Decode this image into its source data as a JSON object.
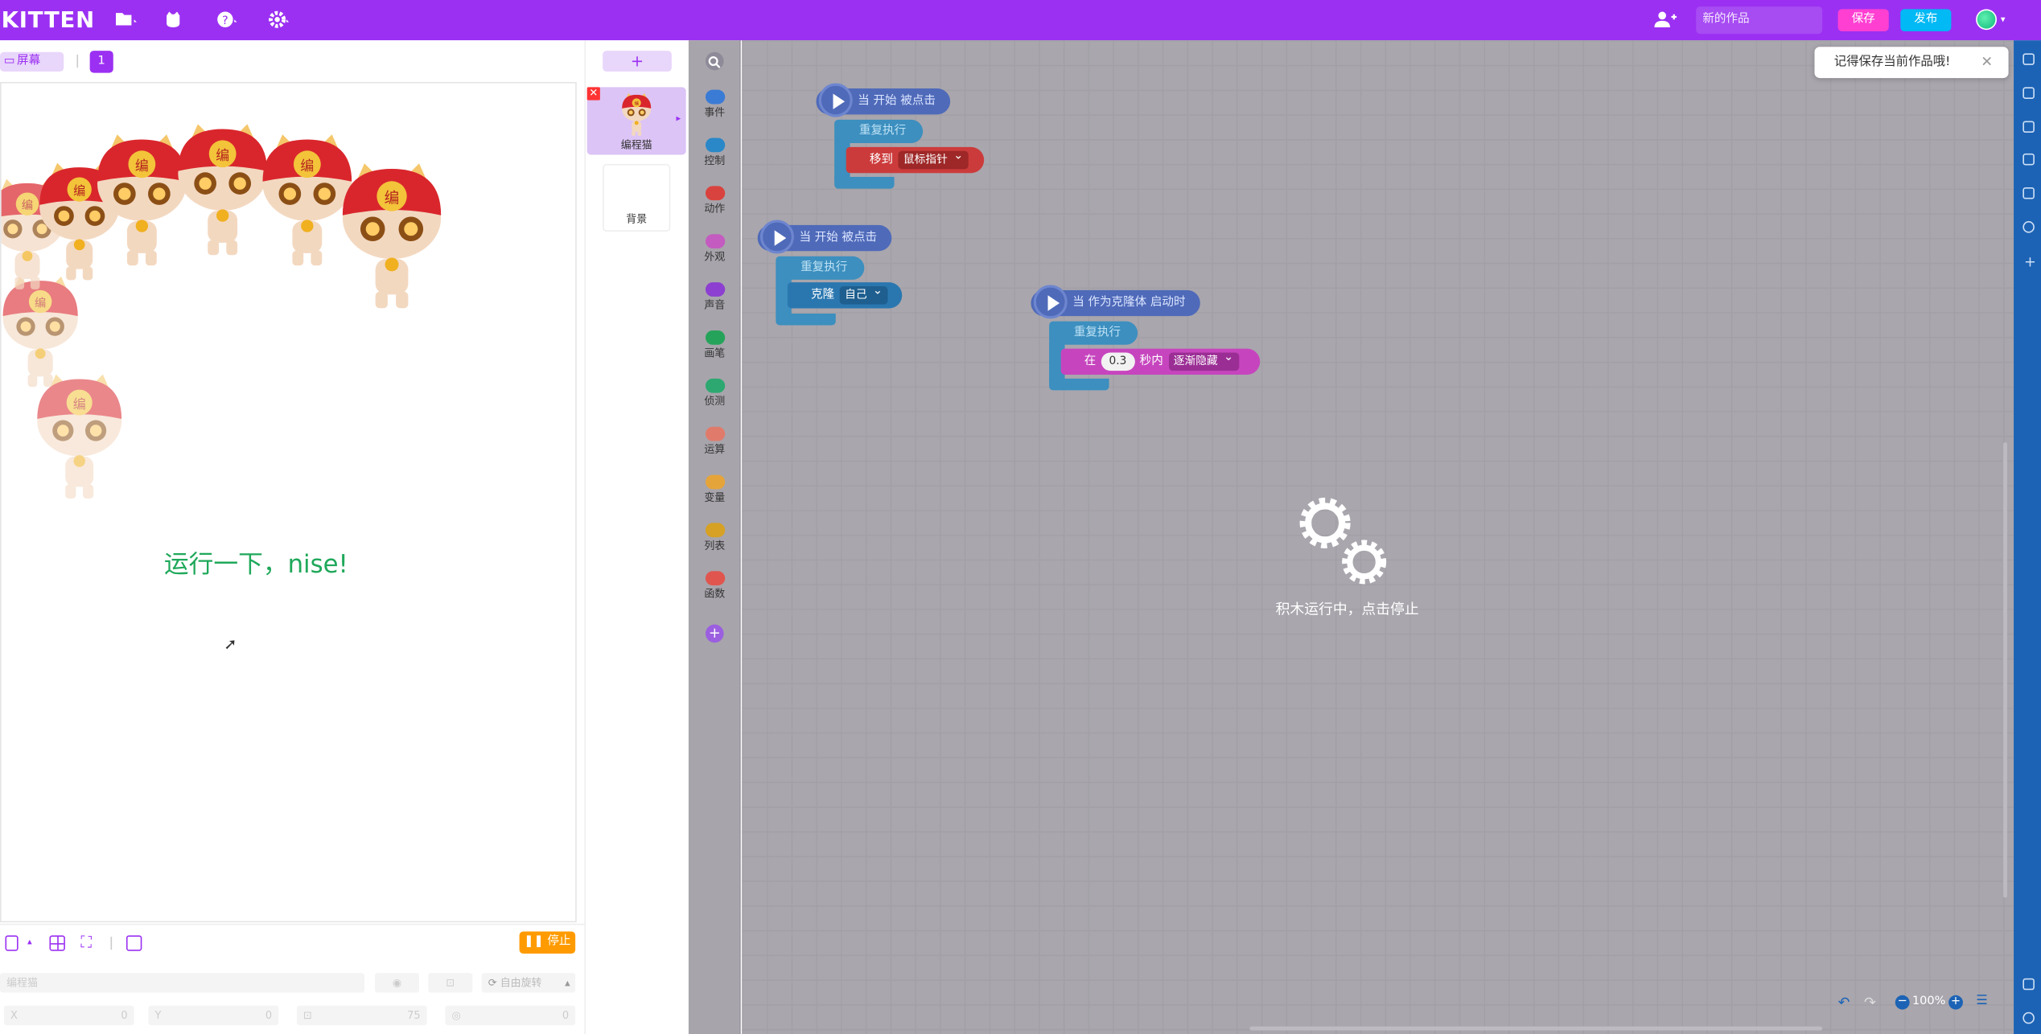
{
  "topbar": {
    "logo": "KITTEN",
    "menu_icons": [
      "folder-icon",
      "cat-icon",
      "help-icon",
      "settings-icon"
    ],
    "project_name": "新的作品",
    "save_label": "保存",
    "publish_label": "发布"
  },
  "stage": {
    "screen_tab": "屏幕",
    "screen_number": "1",
    "canvas_text": "运行一下，nise!",
    "stop_label": "停止",
    "sprite_name_placeholder": "编程猫",
    "rotation_label": "自由旋转",
    "x_label": "X",
    "x_value": "0",
    "y_label": "Y",
    "y_value": "0",
    "size_value": "75",
    "direction_value": "0"
  },
  "sprites": {
    "add_label": "+",
    "items": [
      {
        "label": "编程猫"
      }
    ],
    "background_label": "背景"
  },
  "categories": [
    {
      "label": "事件",
      "color": "#3a7bd5"
    },
    {
      "label": "控制",
      "color": "#2a88c8"
    },
    {
      "label": "动作",
      "color": "#d9433f"
    },
    {
      "label": "外观",
      "color": "#c45bc0"
    },
    {
      "label": "声音",
      "color": "#8c3fd0"
    },
    {
      "label": "画笔",
      "color": "#26a35a"
    },
    {
      "label": "侦测",
      "color": "#2da870"
    },
    {
      "label": "运算",
      "color": "#e07b6b"
    },
    {
      "label": "变量",
      "color": "#e5a43a"
    },
    {
      "label": "列表",
      "color": "#d6a124"
    },
    {
      "label": "函数",
      "color": "#e0564f"
    }
  ],
  "scripts": [
    {
      "hat": "当 开始 被点击",
      "loop": "重复执行",
      "action": "移到",
      "dropdown": "鼠标指针"
    },
    {
      "hat": "当 开始 被点击",
      "loop": "重复执行",
      "action": "克隆",
      "dropdown": "自己"
    },
    {
      "hat": "当 作为克隆体 启动时",
      "loop": "重复执行",
      "prefix": "在",
      "number": "0.3",
      "suffix": "秒内",
      "dropdown": "逐渐隐藏"
    }
  ],
  "workspace": {
    "running_text": "积木运行中，点击停止",
    "toast_text": "记得保存当前作品哦!",
    "zoom": "100%"
  }
}
